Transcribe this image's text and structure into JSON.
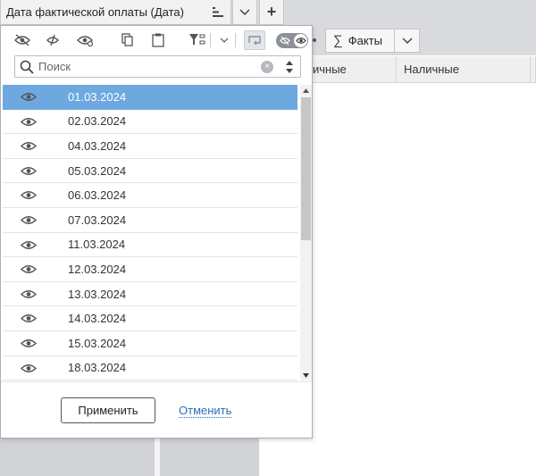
{
  "field_tab": {
    "label": "Дата фактической оплаты (Дата)",
    "sort_icon": "sort-lines-icon"
  },
  "top_buttons": {
    "dropdown_icon": "chevron-down-icon",
    "add_label": "+"
  },
  "facts": {
    "sigma": "∑",
    "label": "Факты",
    "dropdown_icon": "chevron-down-icon"
  },
  "columns": [
    "ичные",
    "Наличные",
    ""
  ],
  "popup": {
    "toolbar_icons": [
      "hide-all-icon",
      "invert-visibility-icon",
      "show-all-icon",
      "copy-icon",
      "paste-icon",
      "filter-settings-icon",
      "dropdown-icon",
      "loop-icon",
      "visibility-toggle-icon"
    ],
    "search": {
      "placeholder": "Поиск",
      "value": ""
    },
    "items": [
      {
        "date": "01.03.2024",
        "selected": true
      },
      {
        "date": "02.03.2024",
        "selected": false
      },
      {
        "date": "04.03.2024",
        "selected": false
      },
      {
        "date": "05.03.2024",
        "selected": false
      },
      {
        "date": "06.03.2024",
        "selected": false
      },
      {
        "date": "07.03.2024",
        "selected": false
      },
      {
        "date": "11.03.2024",
        "selected": false
      },
      {
        "date": "12.03.2024",
        "selected": false
      },
      {
        "date": "13.03.2024",
        "selected": false
      },
      {
        "date": "14.03.2024",
        "selected": false
      },
      {
        "date": "15.03.2024",
        "selected": false
      },
      {
        "date": "18.03.2024",
        "selected": false
      }
    ],
    "apply_label": "Применить",
    "cancel_label": "Отменить"
  },
  "colors": {
    "selected_row": "#6da9e0",
    "link": "#2a6fb8"
  }
}
